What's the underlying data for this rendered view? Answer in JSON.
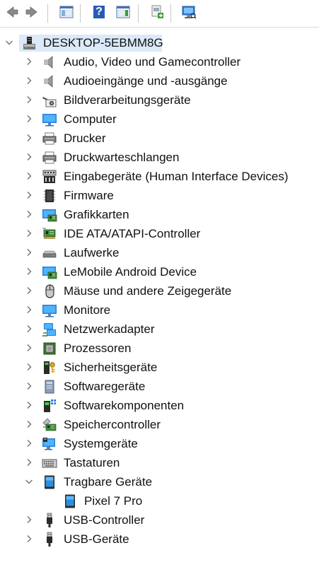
{
  "toolbar": {
    "buttons": [
      {
        "name": "back-button",
        "icon": "arrow-left-icon"
      },
      {
        "name": "forward-button",
        "icon": "arrow-right-icon"
      },
      {
        "name": "show-hide-console-tree-button",
        "icon": "console-tree-icon"
      },
      {
        "name": "help-button",
        "icon": "help-icon",
        "glyph": "?"
      },
      {
        "name": "show-hide-action-pane-button",
        "icon": "action-pane-icon"
      },
      {
        "name": "update-driver-button",
        "icon": "update-driver-icon"
      },
      {
        "name": "scan-hardware-button",
        "icon": "monitor-scan-icon"
      }
    ]
  },
  "tree": {
    "root": {
      "label": "DESKTOP-5EBMM8G",
      "icon": "computer-tower-icon",
      "expanded": true
    },
    "categories": [
      {
        "label": "Audio, Video und Gamecontroller",
        "icon": "speaker-icon",
        "expanded": false
      },
      {
        "label": "Audioeingänge und -ausgänge",
        "icon": "speaker-icon",
        "expanded": false
      },
      {
        "label": "Bildverarbeitungsgeräte",
        "icon": "camera-icon",
        "expanded": false
      },
      {
        "label": "Computer",
        "icon": "monitor-icon",
        "expanded": false
      },
      {
        "label": "Drucker",
        "icon": "printer-icon",
        "expanded": false
      },
      {
        "label": "Druckwarteschlangen",
        "icon": "printer-icon",
        "expanded": false
      },
      {
        "label": "Eingabegeräte (Human Interface Devices)",
        "icon": "hid-icon",
        "expanded": false
      },
      {
        "label": "Firmware",
        "icon": "chip-icon",
        "expanded": false
      },
      {
        "label": "Grafikkarten",
        "icon": "display-adapter-icon",
        "expanded": false
      },
      {
        "label": "IDE ATA/ATAPI-Controller",
        "icon": "controller-card-icon",
        "expanded": false
      },
      {
        "label": "Laufwerke",
        "icon": "disk-drive-icon",
        "expanded": false
      },
      {
        "label": "LeMobile Android Device",
        "icon": "display-adapter-icon",
        "expanded": false
      },
      {
        "label": "Mäuse und andere Zeigegeräte",
        "icon": "mouse-icon",
        "expanded": false
      },
      {
        "label": "Monitore",
        "icon": "monitor-icon",
        "expanded": false
      },
      {
        "label": "Netzwerkadapter",
        "icon": "network-icon",
        "expanded": false
      },
      {
        "label": "Prozessoren",
        "icon": "processor-icon",
        "expanded": false
      },
      {
        "label": "Sicherheitsgeräte",
        "icon": "security-key-icon",
        "expanded": false
      },
      {
        "label": "Softwaregeräte",
        "icon": "software-device-icon",
        "expanded": false
      },
      {
        "label": "Softwarekomponenten",
        "icon": "software-component-icon",
        "expanded": false
      },
      {
        "label": "Speichercontroller",
        "icon": "storage-controller-icon",
        "expanded": false
      },
      {
        "label": "Systemgeräte",
        "icon": "system-devices-icon",
        "expanded": false
      },
      {
        "label": "Tastaturen",
        "icon": "keyboard-icon",
        "expanded": false
      },
      {
        "label": "Tragbare Geräte",
        "icon": "portable-device-icon",
        "expanded": true,
        "children": [
          {
            "label": "Pixel 7 Pro",
            "icon": "portable-device-icon"
          }
        ]
      },
      {
        "label": "USB-Controller",
        "icon": "usb-icon",
        "expanded": false
      },
      {
        "label": "USB-Geräte",
        "icon": "usb-icon",
        "expanded": false
      }
    ]
  },
  "colors": {
    "selection": "#dbe9f9",
    "chevron": "#6b6b6b",
    "icon_blue": "#2a7fd4"
  }
}
